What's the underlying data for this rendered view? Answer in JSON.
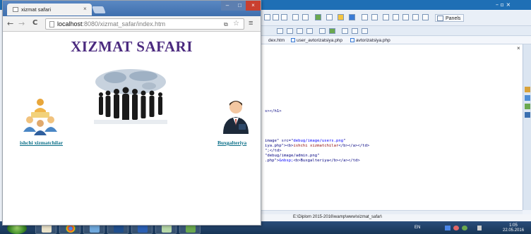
{
  "browser": {
    "tab_title": "xizmat safari",
    "url_host": "localhost",
    "url_rest": ":8080/xizmat_safar/index.htm",
    "close_glyph": "×",
    "back_glyph": "←",
    "forward_glyph": "→",
    "reload_glyph": "C",
    "menu_glyph": "≡",
    "star_glyph": "☆",
    "min_glyph": "–",
    "max_glyph": "□",
    "win_close_glyph": "×"
  },
  "page": {
    "title": "XIZMAT SAFARI",
    "links": [
      {
        "label": "ishchi xizmatchilar",
        "icon": "users-icon"
      },
      {
        "label": "Buxgalteriya",
        "icon": "admin-icon"
      }
    ],
    "banner_icon": "business-people-world-map-image"
  },
  "editor": {
    "panels_label": "Panels",
    "file_tabs": [
      "dex.htm",
      "user_avtorizatsiya.php",
      "avtorizatsiya.php"
    ],
    "code_lines": [
      {
        "a": "s></h1>",
        "b": "",
        "c": ""
      },
      {
        "a": "image\" src=\"",
        "b": "debug/image/users.png",
        "c": "\""
      },
      {
        "a": "iya.php\"><b>",
        "b": "ishchi xizmatchilar",
        "c": "</b></a></td>"
      },
      {
        "a": "\";</td>",
        "b": "",
        "c": ""
      },
      {
        "a": "\"debug/image/admin.png\"",
        "b": "",
        "c": ""
      },
      {
        "a": ".php\">",
        "b": "&nbsp;",
        "c": "<b>Buxgalteriya</b></a></td>"
      }
    ],
    "status_path": "E:\\Diplom 2015-2016\\wamp\\www\\xizmat_safar\\",
    "close_glyph": "×",
    "title_controls": "– ▫ ×"
  },
  "taskbar": {
    "language": "EN",
    "time": "1:05",
    "date": "22.05.2016"
  },
  "colors": {
    "title_purple": "#4b2a7f",
    "link_teal": "#0a6f88",
    "taskbar_blue": "#173556"
  }
}
